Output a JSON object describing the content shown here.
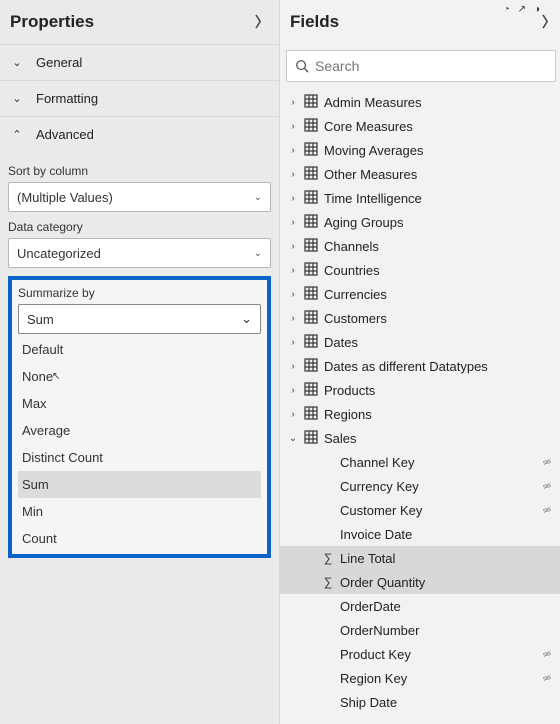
{
  "topbar_icons": [
    "circle",
    "arrow",
    "circle"
  ],
  "properties": {
    "title": "Properties",
    "sections": {
      "general": {
        "label": "General",
        "expanded": false
      },
      "formatting": {
        "label": "Formatting",
        "expanded": false
      },
      "advanced": {
        "label": "Advanced",
        "expanded": true
      }
    },
    "advanced": {
      "sort_by_label": "Sort by column",
      "sort_by_value": "(Multiple Values)",
      "data_category_label": "Data category",
      "data_category_value": "Uncategorized",
      "summarize_label": "Summarize by",
      "summarize_value": "Sum",
      "summarize_options": [
        "Default",
        "None",
        "Max",
        "Average",
        "Distinct Count",
        "Sum",
        "Min",
        "Count"
      ],
      "hover_option": "None",
      "selected_option": "Sum"
    }
  },
  "fields": {
    "title": "Fields",
    "search_placeholder": "Search",
    "tables": [
      {
        "name": "Admin Measures",
        "expanded": false
      },
      {
        "name": "Core Measures",
        "expanded": false
      },
      {
        "name": "Moving Averages",
        "expanded": false
      },
      {
        "name": "Other Measures",
        "expanded": false
      },
      {
        "name": "Time Intelligence",
        "expanded": false
      },
      {
        "name": "Aging Groups",
        "expanded": false
      },
      {
        "name": "Channels",
        "expanded": false
      },
      {
        "name": "Countries",
        "expanded": false
      },
      {
        "name": "Currencies",
        "expanded": false
      },
      {
        "name": "Customers",
        "expanded": false
      },
      {
        "name": "Dates",
        "expanded": false
      },
      {
        "name": "Dates as different Datatypes",
        "expanded": false
      },
      {
        "name": "Products",
        "expanded": false
      },
      {
        "name": "Regions",
        "expanded": false
      },
      {
        "name": "Sales",
        "expanded": true,
        "columns": [
          {
            "name": "Channel Key",
            "hidden": true,
            "sigma": false,
            "selected": false
          },
          {
            "name": "Currency Key",
            "hidden": true,
            "sigma": false,
            "selected": false
          },
          {
            "name": "Customer Key",
            "hidden": true,
            "sigma": false,
            "selected": false
          },
          {
            "name": "Invoice Date",
            "hidden": false,
            "sigma": false,
            "selected": false
          },
          {
            "name": "Line Total",
            "hidden": false,
            "sigma": true,
            "selected": true
          },
          {
            "name": "Order Quantity",
            "hidden": false,
            "sigma": true,
            "selected": true
          },
          {
            "name": "OrderDate",
            "hidden": false,
            "sigma": false,
            "selected": false
          },
          {
            "name": "OrderNumber",
            "hidden": false,
            "sigma": false,
            "selected": false
          },
          {
            "name": "Product Key",
            "hidden": true,
            "sigma": false,
            "selected": false
          },
          {
            "name": "Region Key",
            "hidden": true,
            "sigma": false,
            "selected": false
          },
          {
            "name": "Ship Date",
            "hidden": false,
            "sigma": false,
            "selected": false
          }
        ]
      }
    ]
  }
}
